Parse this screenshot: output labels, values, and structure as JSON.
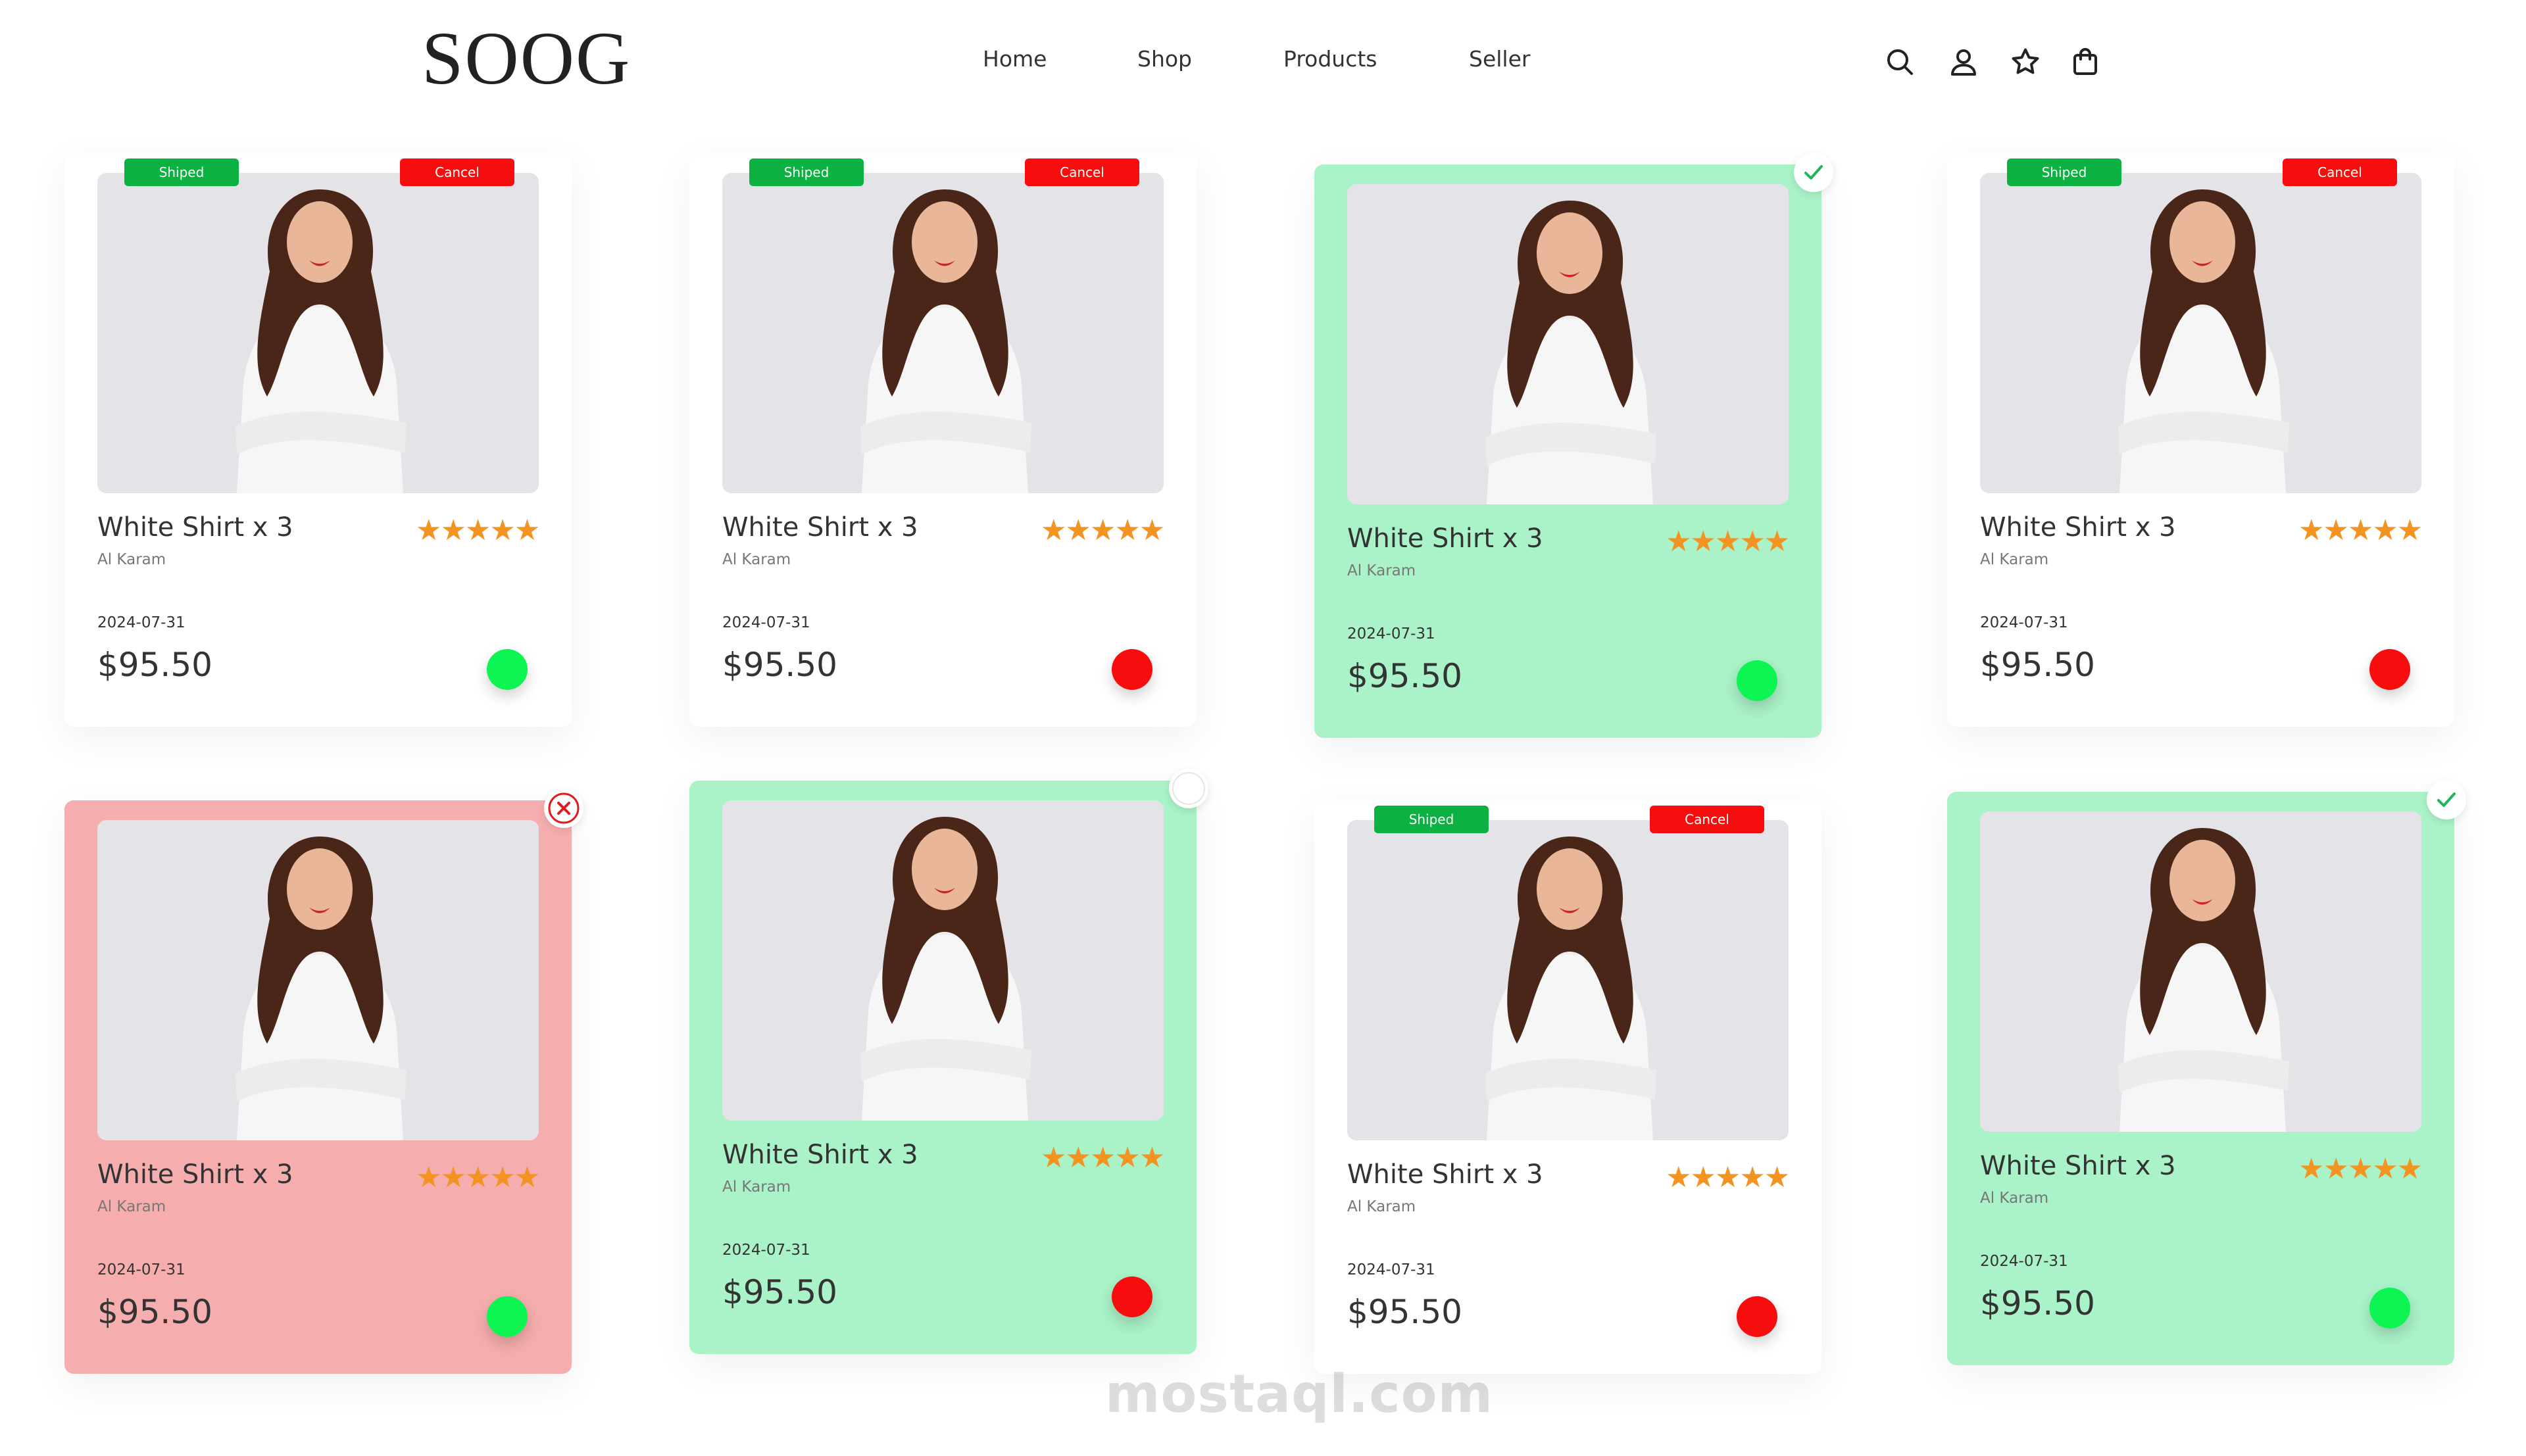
{
  "header": {
    "logo": "SOOG",
    "nav": [
      "Home",
      "Shop",
      "Products",
      "Seller"
    ],
    "icons": [
      "search-icon",
      "user-icon",
      "star-icon",
      "bag-icon"
    ]
  },
  "cards": [
    {
      "state": "default",
      "tag_shipped": "Shiped",
      "tag_cancel": "Cancel",
      "title": "White Shirt x 3",
      "seller": "Al Karam",
      "rating": 5,
      "date": "2024-07-31",
      "price": "$95.50",
      "status_dot": "green"
    },
    {
      "state": "default",
      "tag_shipped": "Shiped",
      "tag_cancel": "Cancel",
      "title": "White Shirt x 3",
      "seller": "Al Karam",
      "rating": 5,
      "date": "2024-07-31",
      "price": "$95.50",
      "status_dot": "red"
    },
    {
      "state": "selected",
      "title": "White Shirt x 3",
      "seller": "Al Karam",
      "rating": 5,
      "date": "2024-07-31",
      "price": "$95.50",
      "status_dot": "green",
      "corner_icon": "check-icon"
    },
    {
      "state": "default",
      "tag_shipped": "Shiped",
      "tag_cancel": "Cancel",
      "title": "White Shirt x 3",
      "seller": "Al Karam",
      "rating": 5,
      "date": "2024-07-31",
      "price": "$95.50",
      "status_dot": "red"
    },
    {
      "state": "rejected",
      "title": "White Shirt x 3",
      "seller": "Al Karam",
      "rating": 5,
      "date": "2024-07-31",
      "price": "$95.50",
      "status_dot": "green",
      "corner_icon": "close-icon"
    },
    {
      "state": "selected",
      "title": "White Shirt x 3",
      "seller": "Al Karam",
      "rating": 5,
      "date": "2024-07-31",
      "price": "$95.50",
      "status_dot": "red",
      "corner_icon": "empty-circle-icon"
    },
    {
      "state": "default",
      "tag_shipped": "Shiped",
      "tag_cancel": "Cancel",
      "title": "White Shirt x 3",
      "seller": "Al Karam",
      "rating": 5,
      "date": "2024-07-31",
      "price": "$95.50",
      "status_dot": "red"
    },
    {
      "state": "selected",
      "title": "White Shirt x 3",
      "seller": "Al Karam",
      "rating": 5,
      "date": "2024-07-31",
      "price": "$95.50",
      "status_dot": "green",
      "corner_icon": "check-icon"
    }
  ],
  "watermark": "mostaql.com",
  "colors": {
    "selected_bg": "#aaf2c8",
    "rejected_bg": "#f6adad",
    "shipped_tag": "#0bb141",
    "cancel_tag": "#f70d0d",
    "dot_green": "#0df553",
    "dot_red": "#f70d0d",
    "star": "#f39422"
  }
}
